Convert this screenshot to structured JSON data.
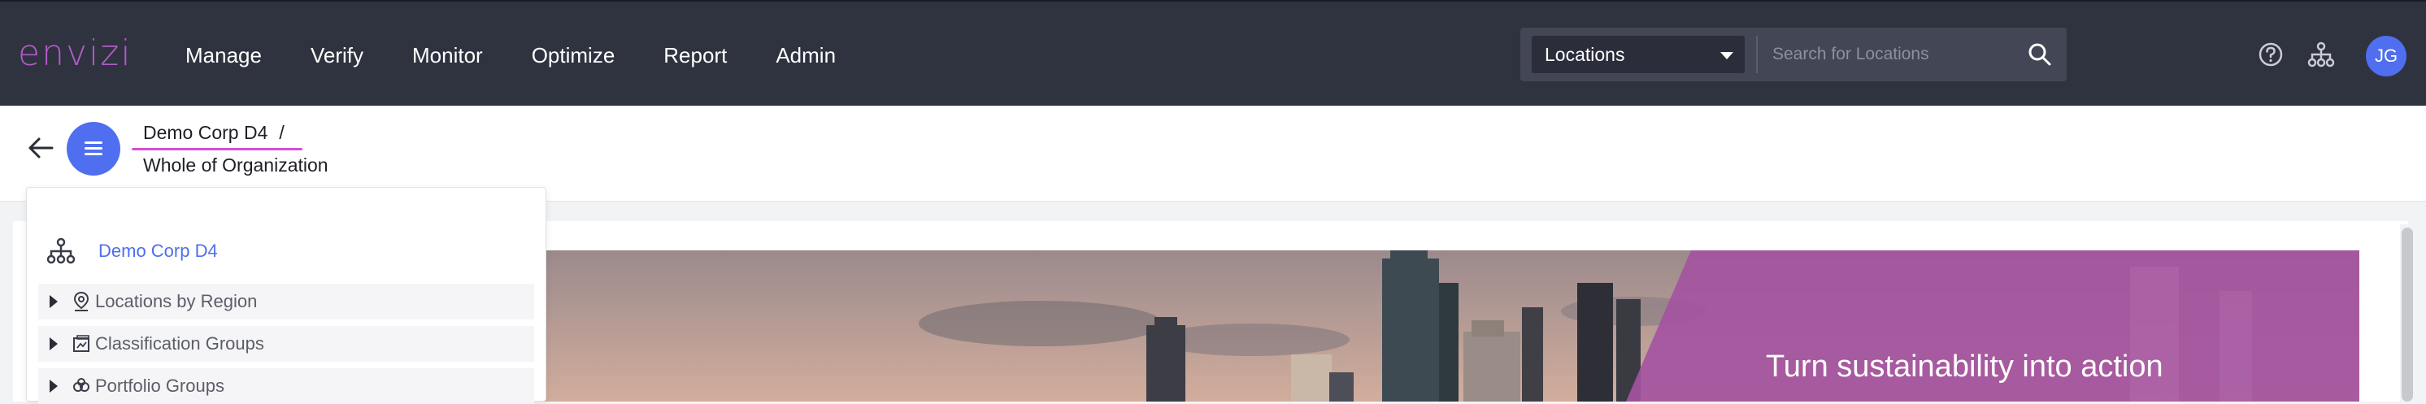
{
  "app": {
    "logo": "envizi"
  },
  "nav": {
    "items": [
      "Manage",
      "Verify",
      "Monitor",
      "Optimize",
      "Report",
      "Admin"
    ]
  },
  "search": {
    "scope": "Locations",
    "placeholder": "Search for Locations"
  },
  "user": {
    "initials": "JG"
  },
  "breadcrumb": {
    "org": "Demo Corp D4",
    "separator": "/",
    "current": "Whole of Organization"
  },
  "tree": {
    "root": "Demo Corp D4",
    "items": [
      {
        "label": "Locations by Region",
        "icon": "location-pin-icon"
      },
      {
        "label": "Classification Groups",
        "icon": "classification-icon"
      },
      {
        "label": "Portfolio Groups",
        "icon": "portfolio-icon"
      }
    ]
  },
  "banner": {
    "headline": "Turn sustainability into action"
  },
  "colors": {
    "topbar": "#2f323f",
    "accent": "#4f6ef0",
    "brand": "#b25bc9",
    "banner_overlay": "#a4549f"
  }
}
